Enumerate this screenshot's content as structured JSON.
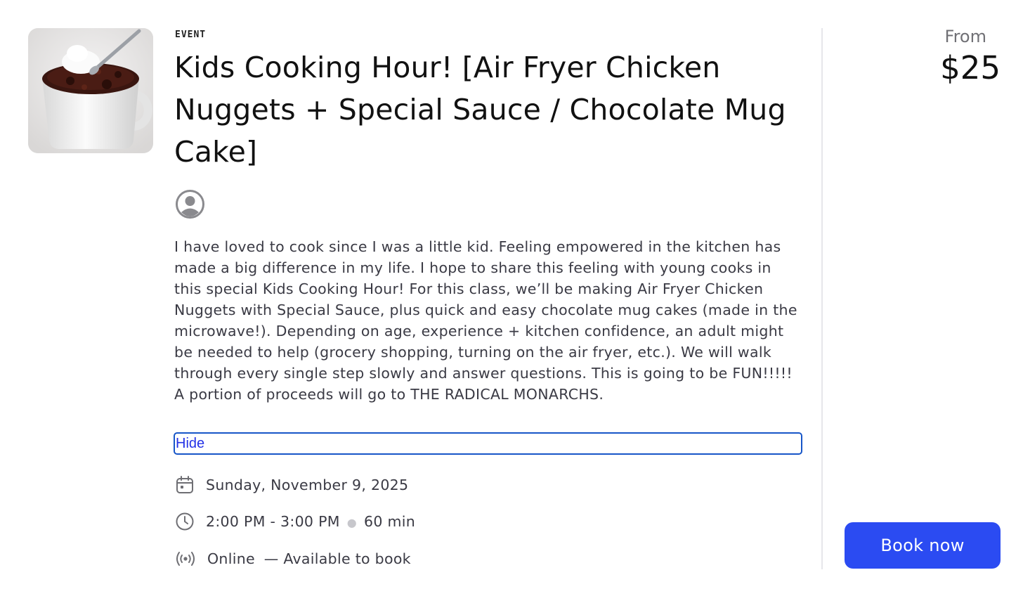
{
  "event": {
    "eyebrow": "EVENT",
    "title": "Kids Cooking Hour! [Air Fryer Chicken Nuggets + Special Sauce / Chocolate Mug Cake]",
    "description": "I have loved to cook since I was a little kid. Feeling empowered in the kitchen has made a big difference in my life. I hope to share this feeling with young cooks in this special Kids Cooking Hour! For this class, we’ll be making Air Fryer Chicken Nuggets with Special Sauce, plus quick and easy chocolate mug cakes (made in the microwave!). Depending on age, experience + kitchen confidence, an adult might be needed to help (grocery shopping, turning on the air fryer, etc.). We will walk through every single step slowly and answer questions. This is going to be FUN!!!!! A portion of proceeds will go to THE RADICAL MONARCHS.",
    "toggle_label": "Hide",
    "date": "Sunday, November 9, 2025",
    "time": "2:00 PM - 3:00 PM",
    "duration": "60 min",
    "location": "Online",
    "availability": "— Available to book"
  },
  "pricing": {
    "from_label": "From",
    "price": "$25",
    "book_label": "Book now"
  },
  "icons": {
    "thumbnail": "chocolate-mug-cake-photo",
    "avatar": "user-avatar-icon",
    "date": "calendar-icon",
    "time": "clock-icon",
    "location": "broadcast-icon"
  },
  "colors": {
    "accent": "#2b4bf2",
    "link": "#2432e6",
    "focus_ring": "#1756c8"
  }
}
